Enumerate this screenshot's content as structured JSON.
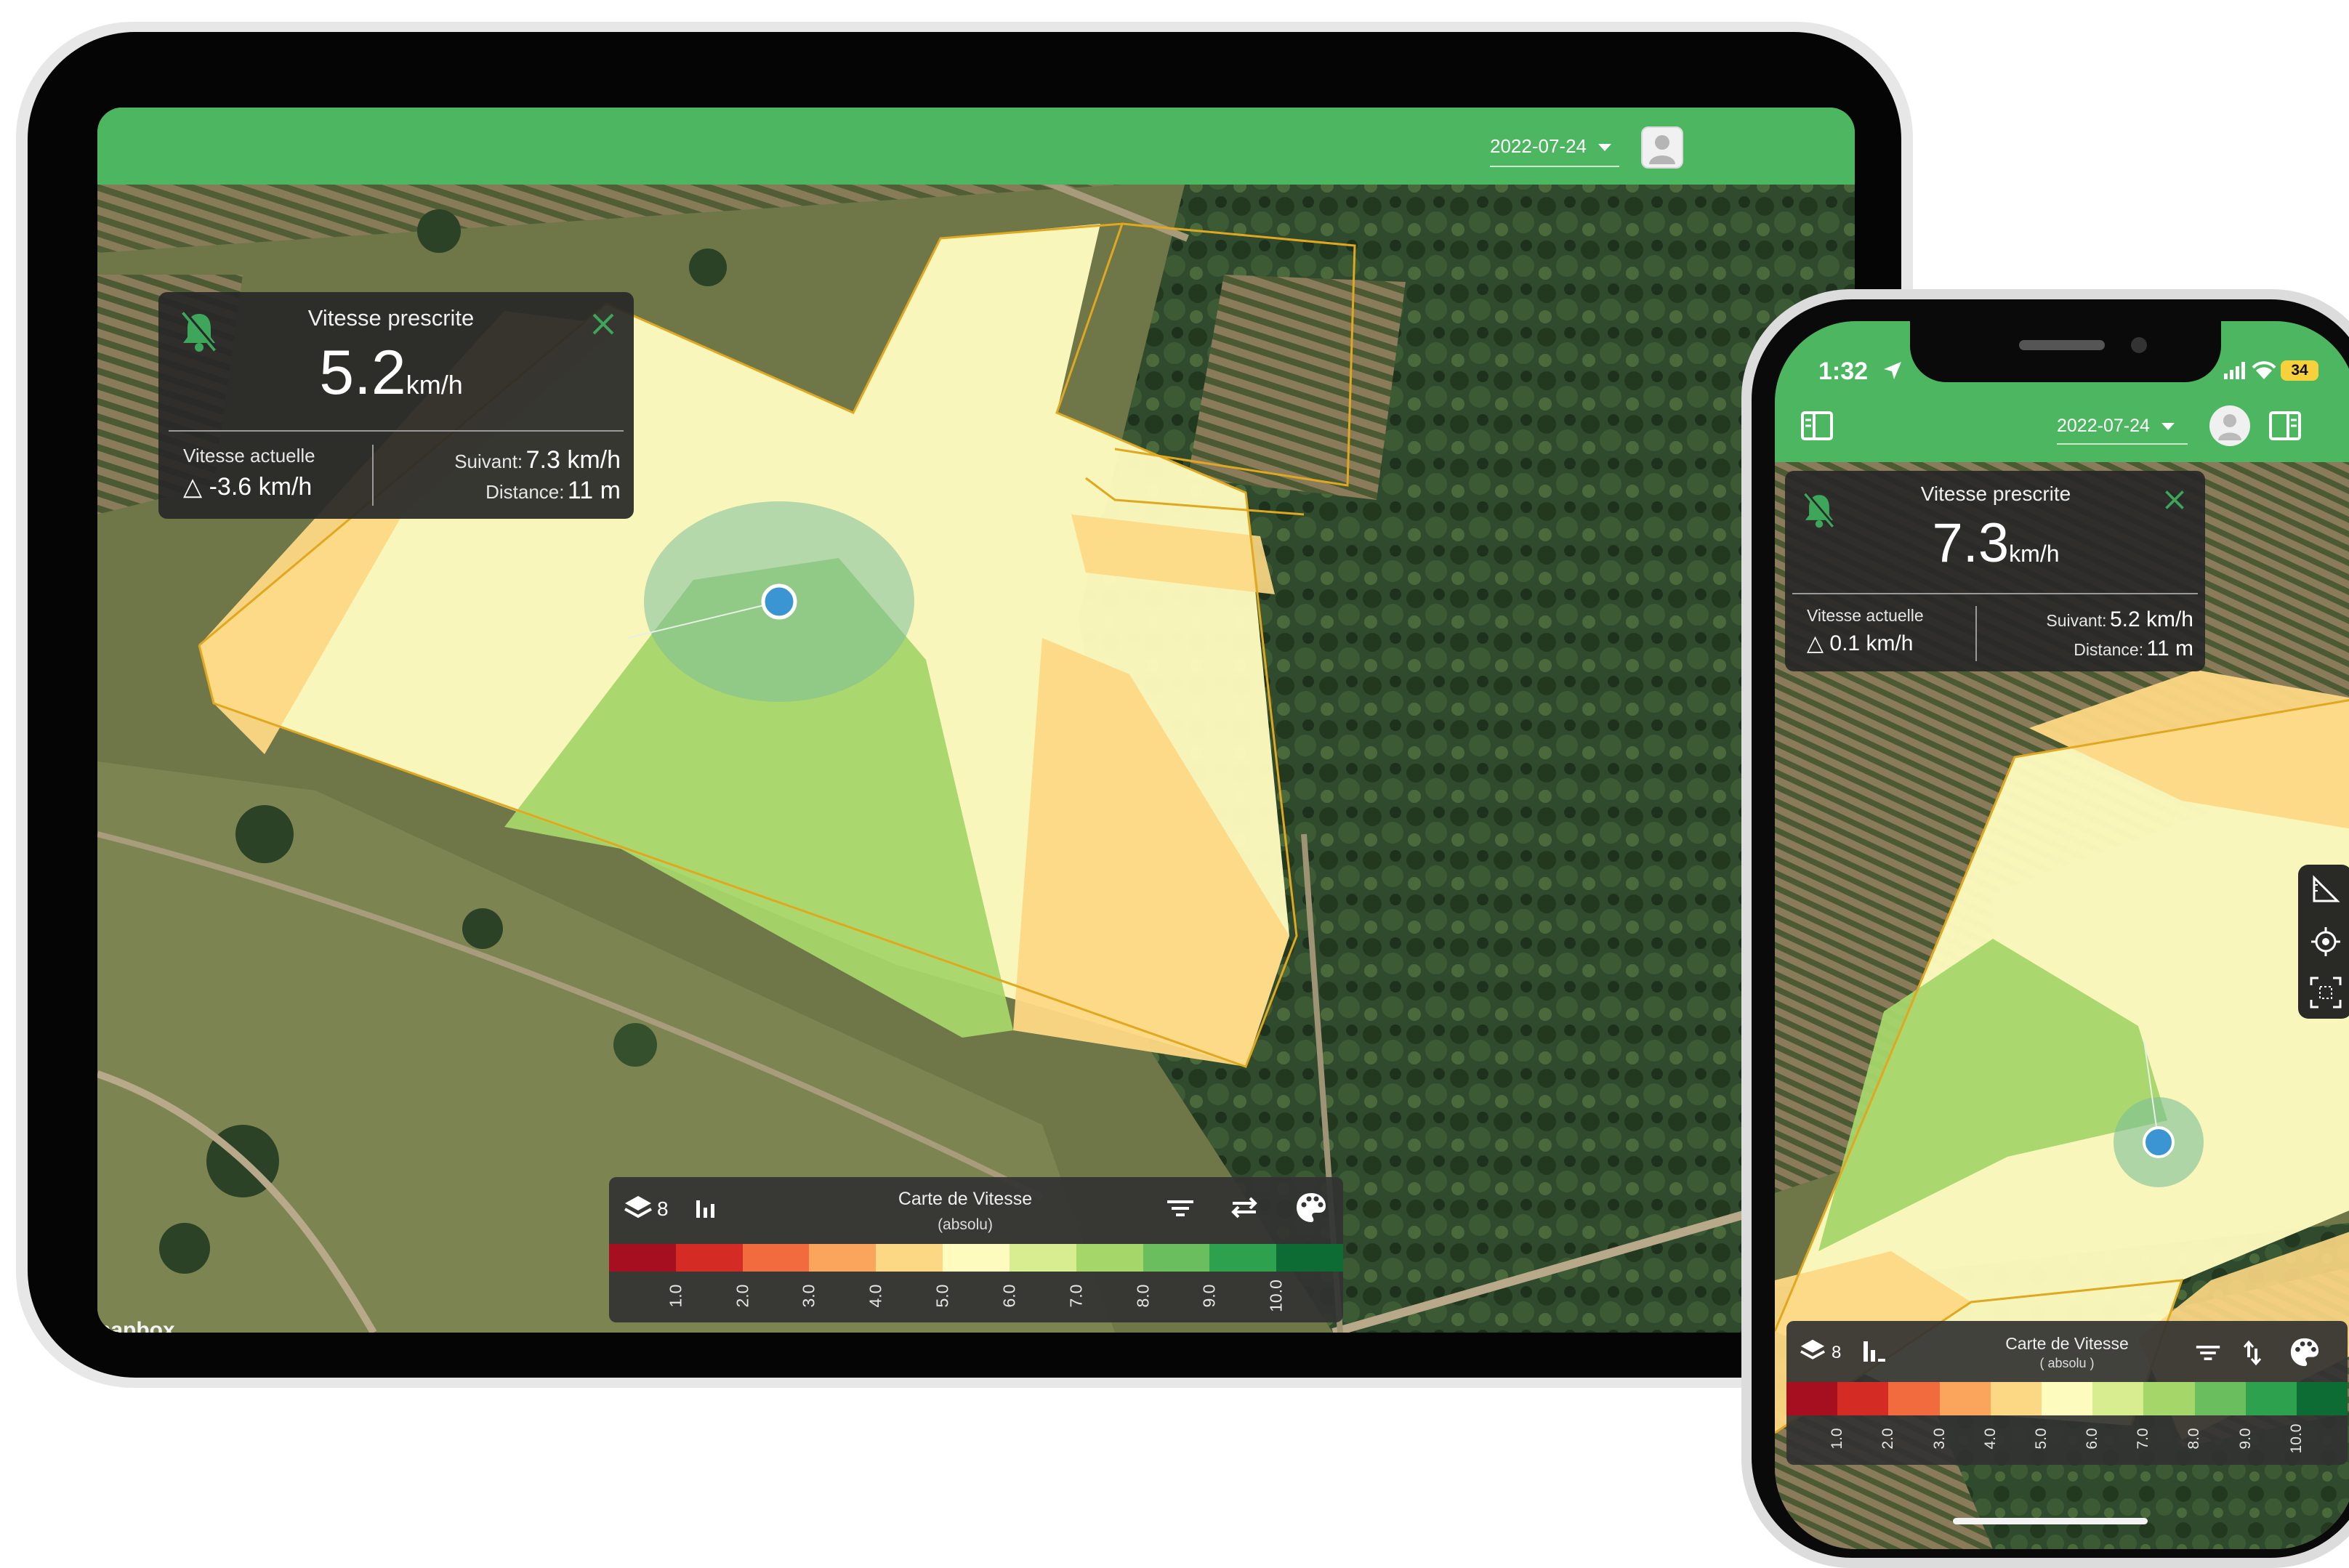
{
  "tablet": {
    "date_selector": "2022-07-24",
    "speed_panel": {
      "title": "Vitesse prescrite",
      "speed_value": "5.2",
      "speed_unit": "km/h",
      "current_label": "Vitesse actuelle",
      "current_value": "△ -3.6 km/h",
      "next_label": "Suivant:",
      "next_value": "7.3 km/h",
      "distance_label": "Distance:",
      "distance_value": "11 m"
    },
    "legend": {
      "layer_count": "8",
      "title": "Carte de Vitesse",
      "subtitle": "(absolu)",
      "ticks": [
        "1.0",
        "2.0",
        "3.0",
        "4.0",
        "5.0",
        "6.0",
        "7.0",
        "8.0",
        "9.0",
        "10.0"
      ]
    },
    "attribution": "napbox"
  },
  "phone": {
    "status_time": "1:32",
    "battery": "34",
    "date_selector": "2022-07-24",
    "speed_panel": {
      "title": "Vitesse prescrite",
      "speed_value": "7.3",
      "speed_unit": "km/h",
      "current_label": "Vitesse actuelle",
      "current_value": "△ 0.1 km/h",
      "next_label": "Suivant:",
      "next_value": "5.2 km/h",
      "distance_label": "Distance:",
      "distance_value": "11 m"
    },
    "legend": {
      "layer_count": "8",
      "title": "Carte de Vitesse",
      "subtitle": "( absolu )",
      "ticks": [
        "1.0",
        "2.0",
        "3.0",
        "4.0",
        "5.0",
        "6.0",
        "7.0",
        "8.0",
        "9.0",
        "10.0"
      ]
    }
  },
  "colors": {
    "header_green": "#4cb660",
    "location_blue": "#3b95d3",
    "ramp": [
      "#a50f20",
      "#d42c25",
      "#f26b3e",
      "#fba45c",
      "#fdd884",
      "#fefbbe",
      "#d8ec90",
      "#a5d66a",
      "#6abe5d",
      "#2ea14e",
      "#0c6c34"
    ]
  },
  "icons": [
    "bell-off-icon",
    "close-icon",
    "layers-icon",
    "bar-chart-icon",
    "filter-icon",
    "swap-icon",
    "palette-icon",
    "ruler-icon",
    "crosshair-icon",
    "scan-icon",
    "sidebar-left-icon",
    "sidebar-right-icon",
    "avatar-icon",
    "location-arrow-icon",
    "signal-icon",
    "wifi-icon",
    "battery-icon"
  ]
}
